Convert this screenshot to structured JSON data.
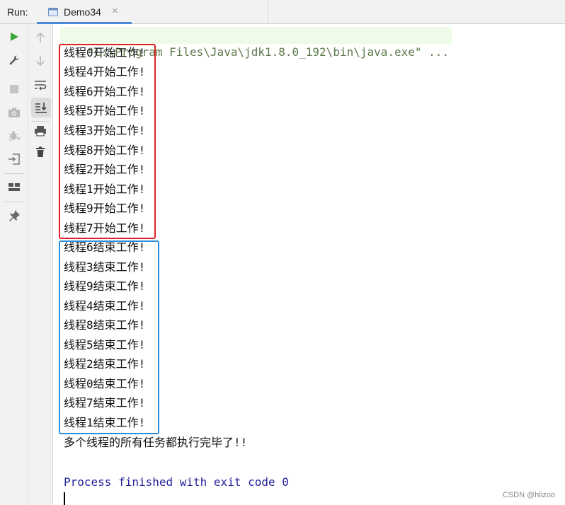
{
  "run_bar": {
    "label": "Run:",
    "tab_title": "Demo34",
    "close_glyph": "×"
  },
  "toolbar_left": [
    {
      "icon": "play-icon",
      "color": "#3aa63a"
    },
    {
      "icon": "wrench-icon"
    },
    {
      "icon": "stop-icon"
    },
    {
      "icon": "camera-icon"
    },
    {
      "icon": "debug-icon"
    },
    {
      "icon": "login-icon"
    },
    {
      "icon": "layout-icon"
    },
    {
      "icon": "pin-icon"
    }
  ],
  "toolbar_right": [
    {
      "icon": "arrow-up-icon"
    },
    {
      "icon": "arrow-down-icon"
    },
    {
      "icon": "soft-wrap-icon"
    },
    {
      "icon": "scroll-to-end-icon",
      "active": true
    },
    {
      "icon": "print-icon"
    },
    {
      "icon": "trash-icon"
    }
  ],
  "console": {
    "command": "\"C:\\Program Files\\Java\\jdk1.8.0_192\\bin\\java.exe\" ...",
    "start_lines": [
      "线程0开始工作!",
      "线程4开始工作!",
      "线程6开始工作!",
      "线程5开始工作!",
      "线程3开始工作!",
      "线程8开始工作!",
      "线程2开始工作!",
      "线程1开始工作!",
      "线程9开始工作!",
      "线程7开始工作!"
    ],
    "end_lines": [
      "线程6结束工作!",
      "线程3结束工作!",
      "线程9结束工作!",
      "线程4结束工作!",
      "线程8结束工作!",
      "线程5结束工作!",
      "线程2结束工作!",
      "线程0结束工作!",
      "线程7结束工作!",
      "线程1结束工作!"
    ],
    "summary": "多个线程的所有任务都执行完毕了!!",
    "process_finished": "Process finished with exit code 0"
  },
  "colors": {
    "red_box": "#e02020",
    "blue_box": "#2a8fe0",
    "process_text": "#22229a",
    "cmd_bg": "#edfbe8"
  },
  "watermark": "CSDN @hlizoo"
}
